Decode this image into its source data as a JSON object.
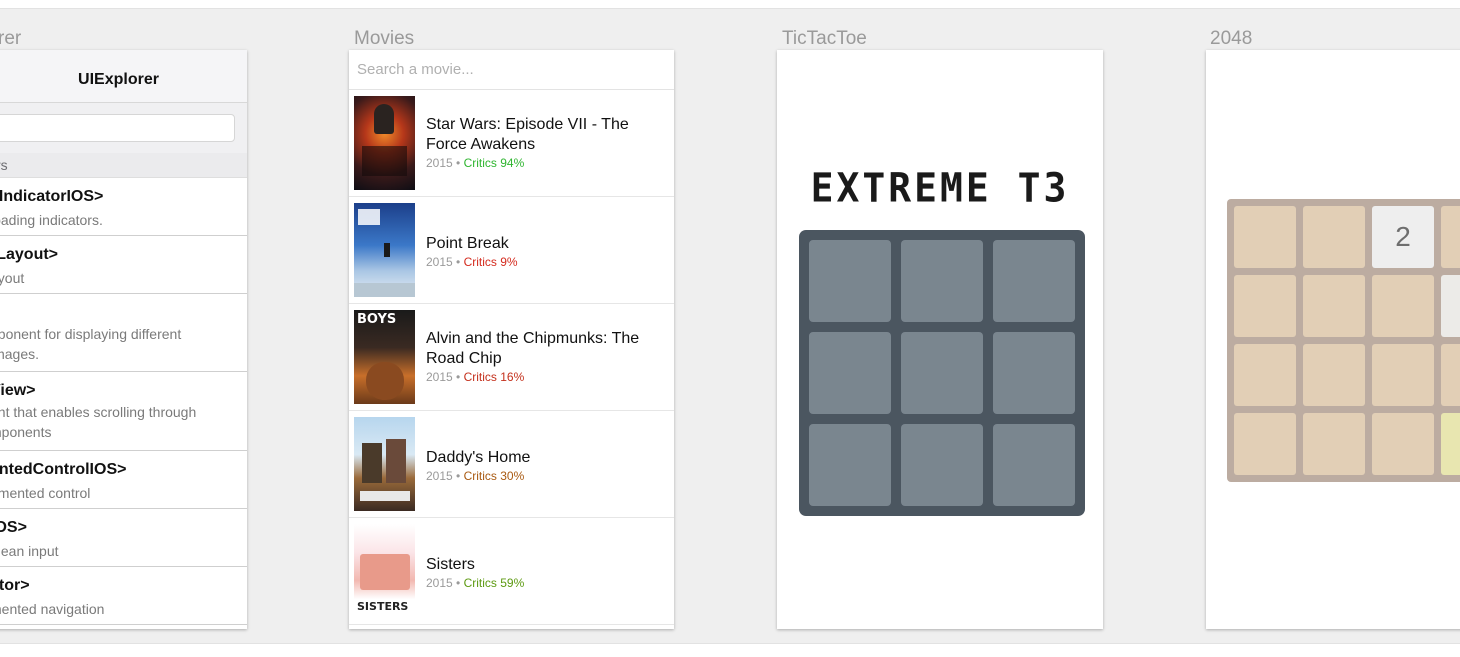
{
  "columns": {
    "uiexplorer": "rer",
    "movies": "Movies",
    "tictactoe": "TicTacToe",
    "game2048": "2048"
  },
  "uiexplorer": {
    "header_title": "UIExplorer",
    "section_label": "rs",
    "items": [
      {
        "title": "yIndicatorIOS>",
        "desc": "loading indicators."
      },
      {
        "title": "rLayout>",
        "desc": "ayout"
      },
      {
        "title": ">",
        "desc": "nponent for displaying different",
        "desc2": "images."
      },
      {
        "title": "View>",
        "desc": "ent that enables scrolling through",
        "desc2": "mponents"
      },
      {
        "title": "entedControlIOS>",
        "desc": "gmented control"
      },
      {
        "title": "IOS>",
        "desc": "olean input"
      },
      {
        "title": "ator>",
        "desc": "mented navigation"
      }
    ]
  },
  "movies": {
    "search_placeholder": "Search a movie...",
    "items": [
      {
        "title": "Star Wars: Episode VII - The Force Awakens",
        "year": "2015",
        "sep": "•",
        "critics": "Critics 94%",
        "critics_color": "#2fb530"
      },
      {
        "title": "Point Break",
        "year": "2015",
        "sep": "•",
        "critics": "Critics 9%",
        "critics_color": "#d42b1e"
      },
      {
        "title": "Alvin and the Chipmunks: The Road Chip",
        "year": "2015",
        "sep": "•",
        "critics": "Critics 16%",
        "critics_color": "#c4301c"
      },
      {
        "title": "Daddy's Home",
        "year": "2015",
        "sep": "•",
        "critics": "Critics 30%",
        "critics_color": "#a95a12"
      },
      {
        "title": "Sisters",
        "year": "2015",
        "sep": "•",
        "critics": "Critics 59%",
        "critics_color": "#5d9a12"
      }
    ],
    "poster_texts": {
      "boys": "BOYS",
      "sisters": "SISTERS"
    }
  },
  "tictactoe": {
    "title": "EXTREME T3",
    "board": [
      "",
      "",
      "",
      "",
      "",
      "",
      "",
      "",
      ""
    ]
  },
  "game2048": {
    "tiles": [
      [
        "",
        "",
        "2",
        ""
      ],
      [
        "",
        "",
        "",
        ""
      ],
      [
        "",
        "",
        "",
        ""
      ],
      [
        "",
        "",
        "",
        ""
      ]
    ]
  }
}
